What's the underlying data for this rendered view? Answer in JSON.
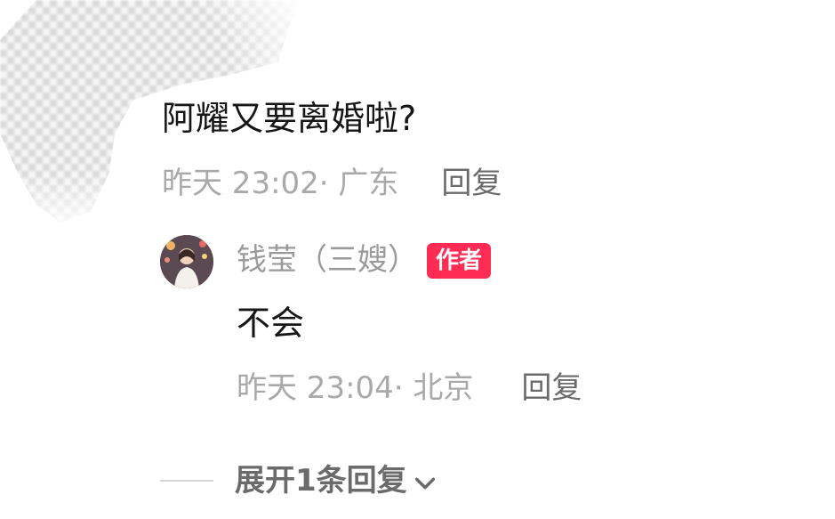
{
  "comment": {
    "text": "阿耀又要离婚啦?",
    "time_location": "昨天 23:02· 广东",
    "reply_label": "回复"
  },
  "author_reply": {
    "avatar_icon": "user-avatar-icon",
    "name": "钱莹（三嫂）",
    "badge": "作者",
    "badge_color": "#fe2c55",
    "text": "不会",
    "time_location": "昨天 23:04· 北京",
    "reply_label": "回复"
  },
  "expand": {
    "label": "展开1条回复",
    "icon": "chevron-down-icon"
  }
}
